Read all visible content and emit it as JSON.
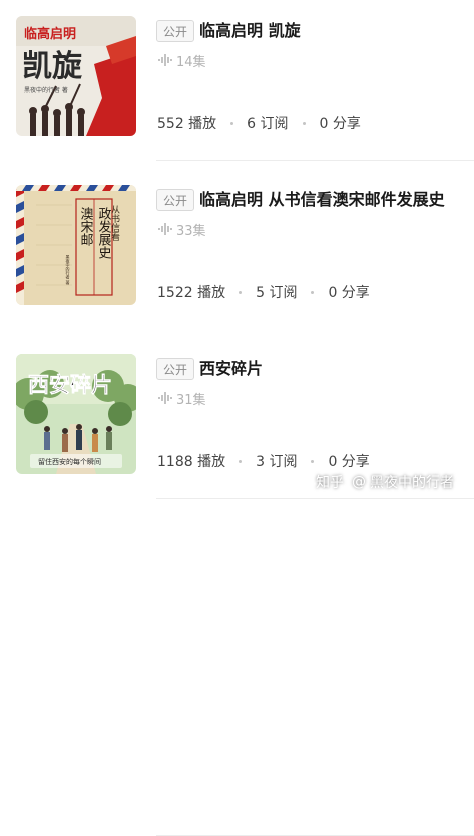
{
  "items": [
    {
      "badge": "公开",
      "title": "临高启明 凯旋",
      "episodes": "14集",
      "plays": "552 播放",
      "subs": "6 订阅",
      "shares": "0 分享",
      "cover": {
        "top_text": "临高启明",
        "big_text": "凯旋",
        "caption": "黑夜中的行者 著"
      }
    },
    {
      "badge": "公开",
      "title": "临高启明 从书信看澳宋邮件发展史",
      "episodes": "33集",
      "plays": "1522 播放",
      "subs": "5 订阅",
      "shares": "0 分享",
      "cover": {
        "side_text": "从书信看",
        "col1": "澳宋邮",
        "col2": "政发展史",
        "caption": "黑夜中的行者 著"
      }
    },
    {
      "badge": "公开",
      "title": "西安碎片",
      "episodes": "31集",
      "plays": "1188 播放",
      "subs": "3 订阅",
      "shares": "0 分享",
      "cover": {
        "big_text": "西安碎片",
        "caption": "留住西安的每个瞬间"
      }
    }
  ],
  "watermark": {
    "site": "知乎",
    "at": "@",
    "user": "黑夜中的行者"
  },
  "colors": {
    "accent_red": "#c8201f",
    "muted": "#b3b3b3",
    "divider": "#ececec"
  }
}
